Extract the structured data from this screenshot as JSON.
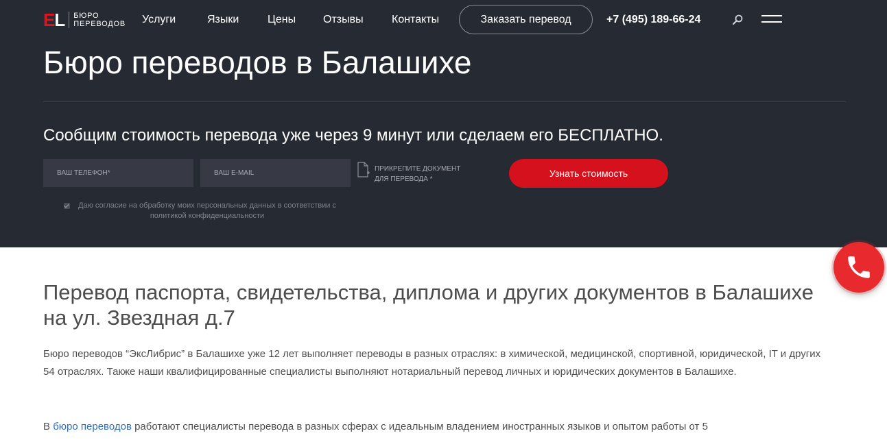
{
  "header": {
    "logo_mark_e": "E",
    "logo_mark_l": "L",
    "logo_line1": "БЮРО",
    "logo_line2": "ПЕРЕВОДОВ",
    "nav": [
      {
        "label": "Услуги"
      },
      {
        "label": "Языки"
      },
      {
        "label": "Цены"
      },
      {
        "label": "Отзывы"
      },
      {
        "label": "Контакты"
      }
    ],
    "order_button": "Заказать перевод",
    "phone": "+7 (495) 189-66-24"
  },
  "hero": {
    "title": "Бюро переводов в Балашихе",
    "subtitle": "Сообщим стоимость перевода уже через 9 минут или сделаем его БЕСПЛАТНО.",
    "phone_placeholder": "ВАШ ТЕЛЕФОН*",
    "email_placeholder": "ВАШ E-MAIL",
    "attach_line1": "ПРИКРЕПИТЕ ДОКУМЕНТ",
    "attach_line2": "ДЛЯ ПЕРЕВОДА *",
    "cta": "Узнать стоимость",
    "consent": "Даю согласие на обработку моих персональных данных в соответствии с политикой конфиденциальности"
  },
  "content": {
    "title": "Перевод паспорта, свидетельства, диплома и других документов в Балашихе на ул. Звездная д.7",
    "paragraph1": "Бюро переводов “ЭксЛибрис” в Балашихе уже 12 лет выполняет переводы в разных отраслях: в химической, медицинской, спортивной, юридической, IT и других 54 отраслях. Также наши квалифицированные специалисты выполняют нотариальный перевод личных и юридических документов в Балашихе.",
    "paragraph2_prefix": "В ",
    "paragraph2_link": "бюро переводов",
    "paragraph2_rest": " работают специалисты перевода в разных сферах с идеальным владением иностранных языков и опытом работы от 5"
  },
  "colors": {
    "hero_background": "#262a33",
    "accent_red": "#d5111d",
    "link_blue": "#2f6fb8"
  },
  "icons": {
    "search": "search-icon",
    "menu": "menu-icon",
    "attach": "document-attach-icon",
    "call": "phone-call-icon"
  }
}
